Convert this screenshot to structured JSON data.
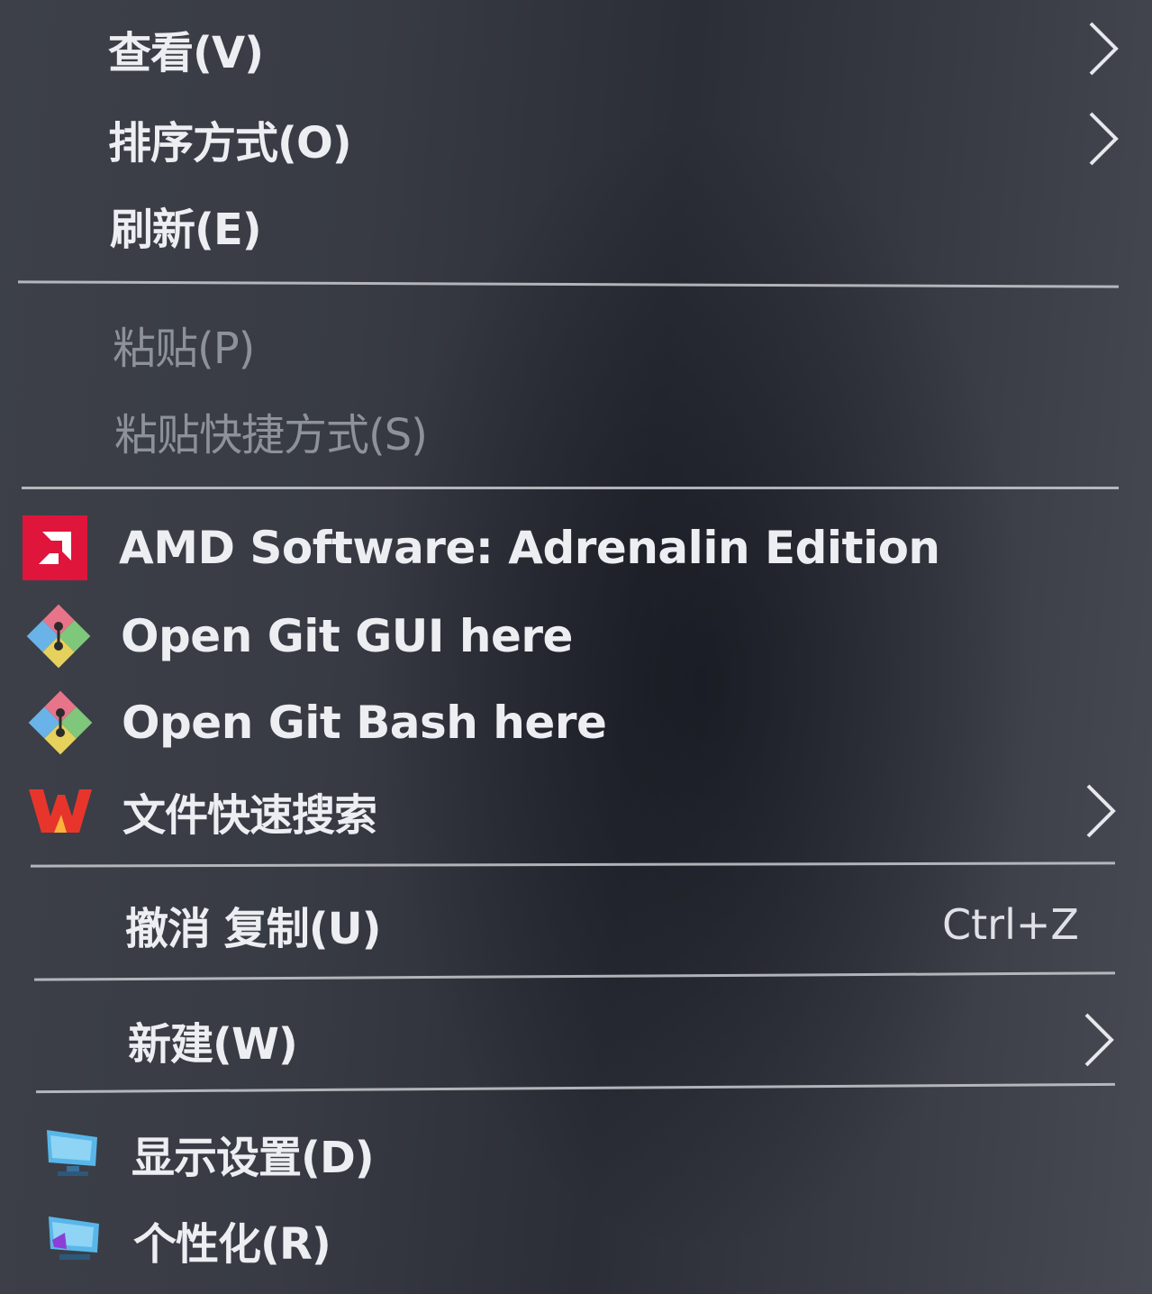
{
  "menu": {
    "view": {
      "label": "查看(V)"
    },
    "sort": {
      "label": "排序方式(O)"
    },
    "refresh": {
      "label": "刷新(E)"
    },
    "paste": {
      "label": "粘贴(P)"
    },
    "paste_shortcut": {
      "label": "粘贴快捷方式(S)"
    },
    "amd": {
      "label": "AMD Software: Adrenalin Edition",
      "icon": "amd-icon",
      "icon_color": "#e0153b"
    },
    "git_gui": {
      "label": "Open Git GUI here",
      "icon": "git-icon"
    },
    "git_bash": {
      "label": "Open Git Bash here",
      "icon": "git-icon"
    },
    "file_search": {
      "label": "文件快速搜索",
      "icon": "wps-icon",
      "icon_color": "#e8352c"
    },
    "undo": {
      "label": "撤消 复制(U)",
      "shortcut": "Ctrl+Z"
    },
    "new": {
      "label": "新建(W)"
    },
    "display": {
      "label": "显示设置(D)",
      "icon": "display-icon"
    },
    "personalize": {
      "label": "个性化(R)",
      "icon": "personalize-icon"
    }
  },
  "colors": {
    "text": "#eceef2",
    "disabled_text": "#8d919a",
    "separator": "#c9cbd0"
  }
}
